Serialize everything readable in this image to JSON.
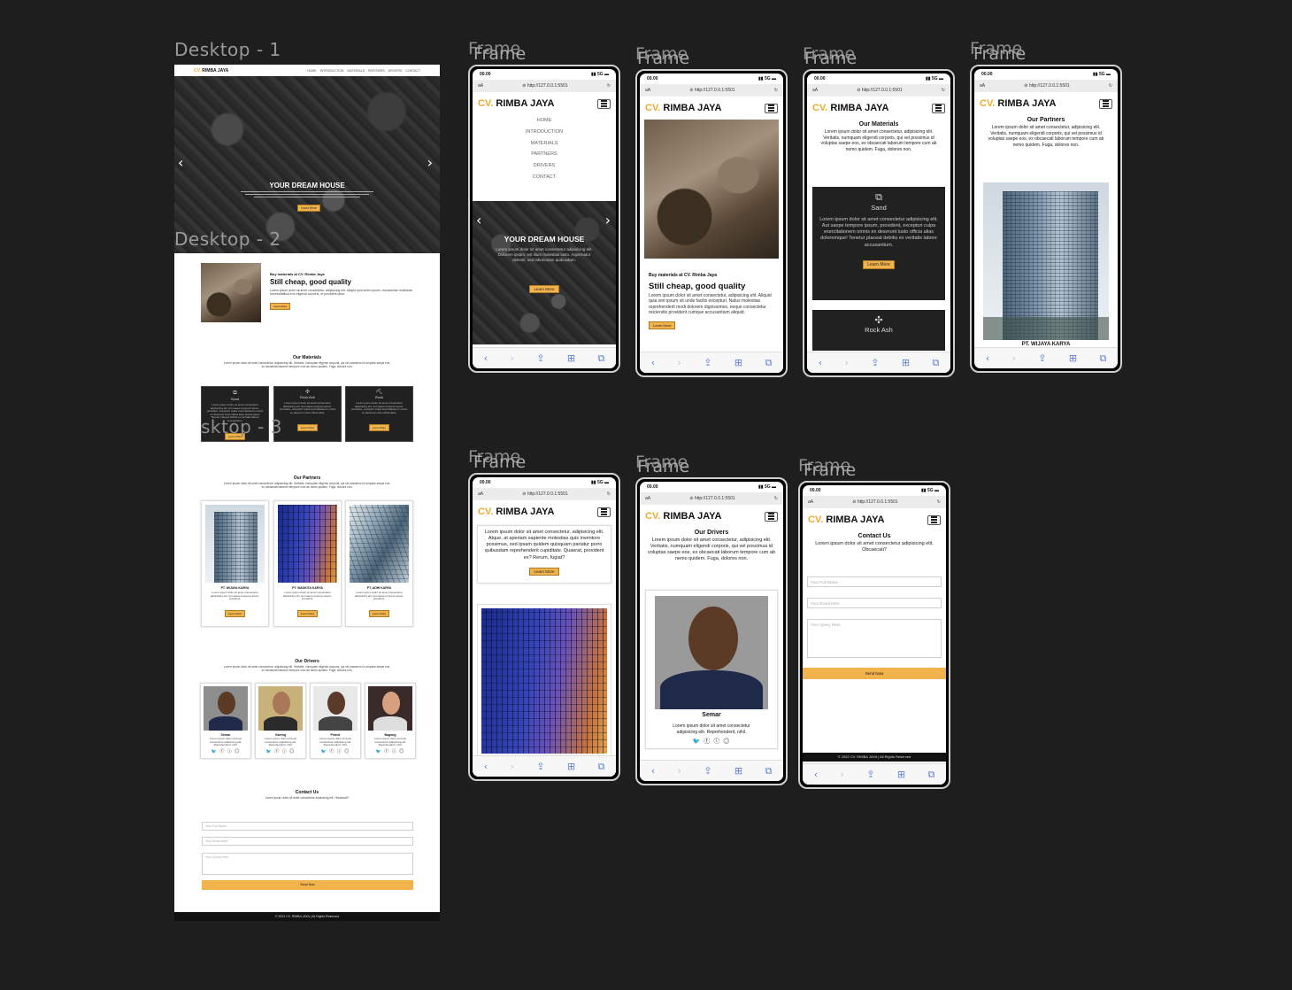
{
  "canvas_titles": {
    "desktop1": "Desktop - 1",
    "desktop2": "Desktop - 2",
    "desktop3": "sktop - 3",
    "frame": "Frame"
  },
  "brand": {
    "prefix": "CV.",
    "name": "RIMBA JAYA",
    "accent": "#f3b34c"
  },
  "nav": [
    "HOME",
    "INTRODUCTION",
    "MATERIALS",
    "PARTNERS",
    "DRIVERS",
    "CONTACT"
  ],
  "hero": {
    "title": "YOUR DREAM HOUSE",
    "button": "Learn More",
    "prev": "‹",
    "next": "›"
  },
  "intro": {
    "eyebrow": "Buy materials at CV. Rimba Jaya",
    "title": "Still cheap, good quality",
    "body": "Lorem ipsum dolor sit amet consectetur, adipisicing elit. Aliquid quia lorem ipsum, recusandae molestiae necessitatibus eos eligendi corporis, ut provident dolor.",
    "button": "Learn More"
  },
  "materials": {
    "title": "Our Materials",
    "subtitle": "Lorem ipsum dolor sit amet consectetur, adipisicing elit. Veritatis, numquam eligendi corporis, qui vel possimus id voluptas saepe eos, ex obcaecati laborum tempore cum ab nemo quidem. Fuga, dolores non.",
    "items": [
      {
        "name": "Sand",
        "body": "Lorem ipsum dolor sit amet consectetur adipisicing elit. Aut saepe tempore ipsum, provident, excepturi culpa exercitationem omnis ex deserunt iusto officia alias doloremque! Tenetur placeat debitis ex veritatis labore accusantium.",
        "button": "Learn More"
      },
      {
        "name": "Rock Ash",
        "body": "Lorem ipsum dolor sit amet consectetur adipisicing elit. Aut saepe tempore ipsum, provident, excepturi culpa exercitationem omnis ex deserunt iusto officia alias.",
        "button": "Learn More"
      },
      {
        "name": "Rock",
        "body": "Lorem ipsum dolor sit amet consectetur adipisicing elit. Aut saepe tempore ipsum, provident, excepturi culpa exercitationem omnis ex deserunt iusto officia alias.",
        "button": "Learn More"
      }
    ]
  },
  "partners": {
    "title": "Our Partners",
    "subtitle": "Lorem ipsum dolor sit amet consectetur, adipisicing elit. Veritatis, numquam eligendi corporis, qui vel possimus id voluptas saepe eos, ex obcaecati laborum tempore cum ab nemo quidem. Fuga, dolores non.",
    "items": [
      {
        "name": "PT. WIJAYA KARYA",
        "body": "Lorem ipsum dolor sit amet consectetur adipisicing elit. Aut saepe tempore ipsum, provident.",
        "button": "Learn More"
      },
      {
        "name": "PT. WASKITA KARYA",
        "body": "Lorem ipsum dolor sit amet consectetur adipisicing elit. Aut saepe tempore ipsum, provident.",
        "button": "Learn More"
      },
      {
        "name": "PT. ADHI KARYA",
        "body": "Lorem ipsum dolor sit amet consectetur adipisicing elit. Aut saepe tempore ipsum, provident.",
        "button": "Learn More"
      }
    ]
  },
  "drivers": {
    "title": "Our Drivers",
    "subtitle": "Lorem ipsum dolor sit amet consectetur, adipisicing elit. Veritatis, numquam eligendi corporis, qui vel possimus id voluptas saepe eos, ex obcaecati laborum tempore cum ab nemo quidem. Fuga, dolores non.",
    "items": [
      {
        "name": "Semar",
        "body": "Lorem ipsum dolor sit amet consectetur adipisicing elit. Reprehenderit, nihil."
      },
      {
        "name": "Gareng",
        "body": "Lorem ipsum dolor sit amet consectetur adipisicing elit. Reprehenderit, nihil."
      },
      {
        "name": "Petruk",
        "body": "Lorem ipsum dolor sit amet consectetur adipisicing elit. Reprehenderit, nihil."
      },
      {
        "name": "Bagong",
        "body": "Lorem ipsum dolor sit amet consectetur adipisicing elit. Reprehenderit, nihil."
      }
    ],
    "social": "🐦 ⓕ ⓘ ◎"
  },
  "contact": {
    "title": "Contact Us",
    "subtitle": "Lorem ipsum dolor sit amet consectetur adipisicing elit. Obcaecati?",
    "name_placeholder": "Your Full Name",
    "email_placeholder": "Your Email Here",
    "query_placeholder": "Your Query Here",
    "button": "Send Now"
  },
  "footer": {
    "text": "© 2022 CV. RIMBA JAYA | All Rights Reserved"
  },
  "phone": {
    "time": "00.00",
    "signal": "▮▮ 5G ▬",
    "aa": "aA",
    "url": "⊘ http://127.0.0.1:5501",
    "reload": "↻",
    "tabs": [
      "‹",
      "›",
      "⇪",
      "⊞",
      "⧉"
    ]
  },
  "phone_content": {
    "partners_title": "Our Partners",
    "partners_sub": "Lorem ipsum dolor sit amet consectetur, adipisicing elit. Veritatis, numquam eligendi corporis, qui vel possimus id voluptas saepe eos, ex obcaecati laborum tempore cum ab nemo quidem. Fuga, dolores non.",
    "partner_name": "PT. WIJAYA KARYA",
    "partner_long": "Lorem ipsum dolor sit amet consectetur, adipisicing elit. Atque, at aperiam sapiente molestias quis inventore possimus, sed ipsam quidem quisquam pariatur porro quibusdam reprehenderit cupiditate. Quaerat, provident ex? Rerum, fugiat?",
    "hero_body": "Lorem ipsum dolor sit amet consectetur adipisicing elit. Dolorem ipsam, est illum molestias iusto. Aspernatur deleniti, sed laboriosam quibusdam.",
    "materials_sub": "Lorem ipsum dolor sit amet consectetur, adipisicing elit. Veritatis, numquam eligendi corporis, qui vel possimus id voluptas saepe eos, ex obcaecati laborum tempore cum ab nemo quidem. Fuga, dolores non.",
    "intro_body": "Lorem ipsum dolor sit amet consectetur, adipisicing elit. Aliquid quia sint ipsum sit unde facilis excepturi. Natus molestias reprehenderit modi dolorem dignissimos, neque consectetur reiciendis provident cumque accusantium aliquid.",
    "drivers_sub": "Lorem ipsum dolor sit amet consectetur, adipisicing elit. Veritatis, numquam eligendi corporis, qui vel possimus id voluptas saepe eos, ex obcaecati laborum tempore cum ab nemo quidem. Fuga, dolores non."
  }
}
